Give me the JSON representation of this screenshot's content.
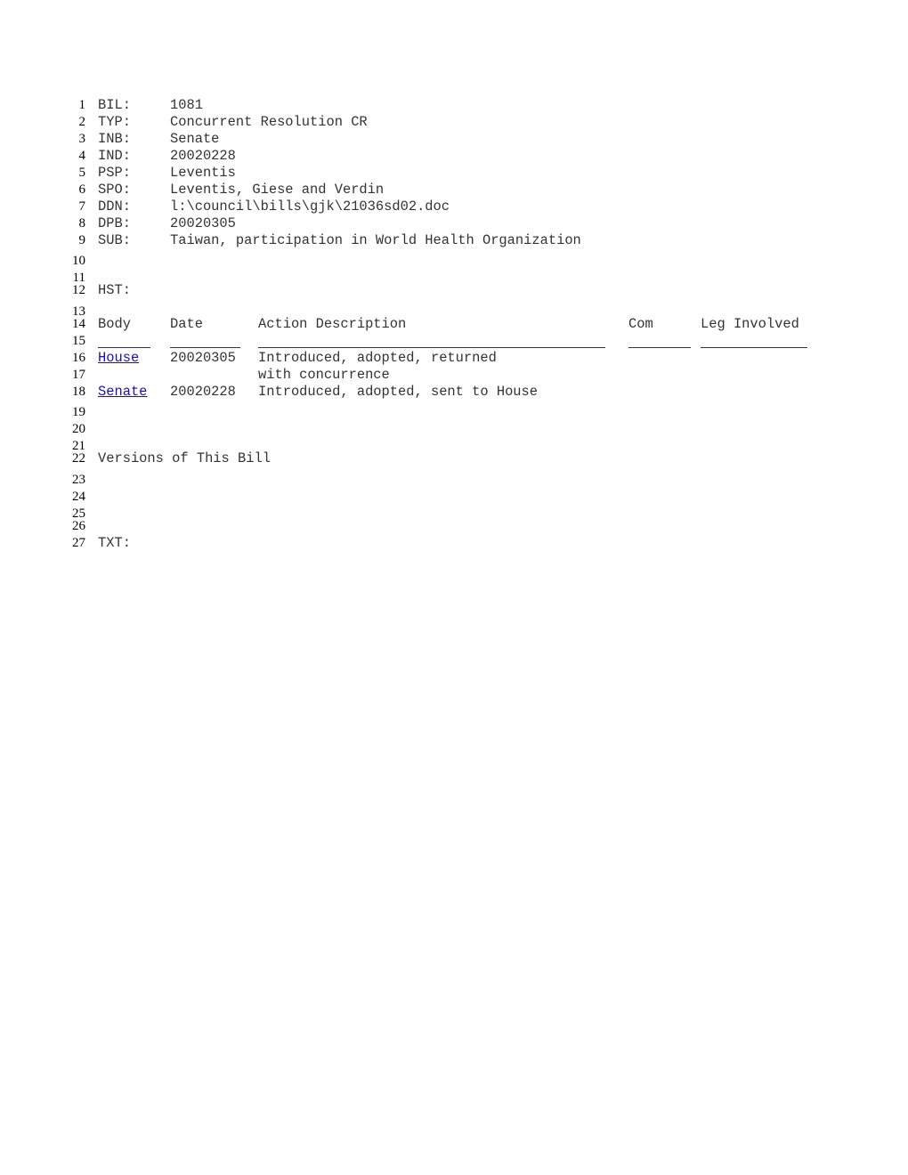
{
  "fields": [
    {
      "key": "BIL:",
      "value": "1081"
    },
    {
      "key": "TYP:",
      "value": "Concurrent Resolution CR"
    },
    {
      "key": "INB:",
      "value": "Senate"
    },
    {
      "key": "IND:",
      "value": "20020228"
    },
    {
      "key": "PSP:",
      "value": "Leventis"
    },
    {
      "key": "SPO:",
      "value": "Leventis, Giese and Verdin"
    },
    {
      "key": "DDN:",
      "value": "l:\\council\\bills\\gjk\\21036sd02.doc"
    },
    {
      "key": "DPB:",
      "value": "20020305"
    },
    {
      "key": "SUB:",
      "value": "Taiwan, participation in World Health Organization"
    }
  ],
  "history": {
    "label": "HST:",
    "columns": [
      "Body",
      "Date",
      "Action Description",
      "Com",
      "Leg Involved"
    ],
    "rows": [
      {
        "body": "House",
        "date": "20020305",
        "action": "Introduced, adopted, returned",
        "action_cont": "with concurrence"
      },
      {
        "body": "Senate",
        "date": "20020228",
        "action": "Introduced, adopted, sent to House"
      }
    ]
  },
  "versions_label": "Versions of This Bill",
  "text_label": "TXT:",
  "line_numbers": [
    "1",
    "2",
    "3",
    "4",
    "5",
    "6",
    "7",
    "8",
    "9",
    "10",
    "11",
    "12",
    "13",
    "14",
    "15",
    "16",
    "17",
    "18",
    "19",
    "20",
    "21",
    "22",
    "23",
    "24",
    "25",
    "26",
    "27"
  ]
}
